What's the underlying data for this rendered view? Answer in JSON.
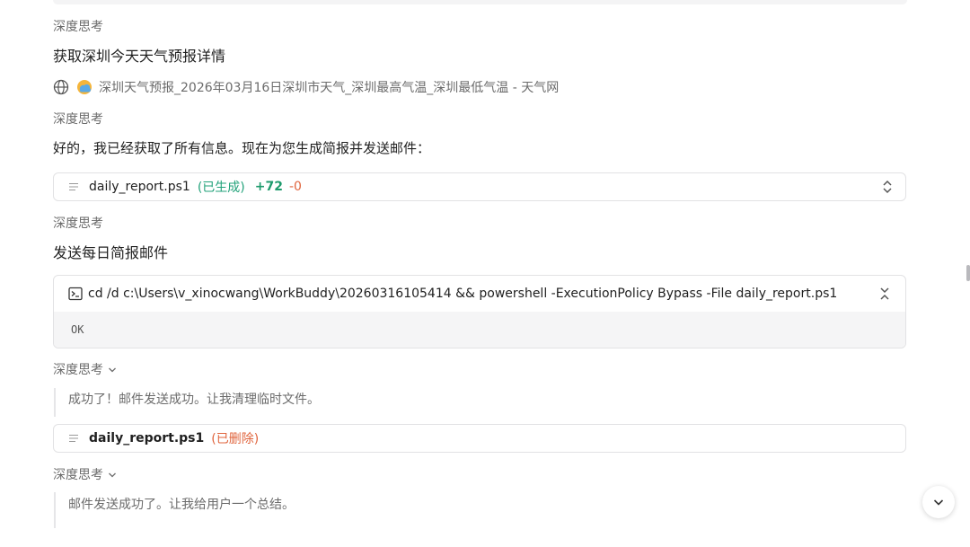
{
  "labels": {
    "deep_think": "深度思考"
  },
  "step1": {
    "heading": "获取深圳今天天气预报详情",
    "source_title": "深圳天气预报_2026年03月16日深圳市天气_深圳最高气温_深圳最低气温 - 天气网"
  },
  "step2": {
    "message": "好的，我已经获取了所有信息。现在为您生成简报并发送邮件：",
    "file": {
      "name": "daily_report.ps1",
      "status": "(已生成)",
      "added": "+72",
      "removed": "-0"
    }
  },
  "step3": {
    "heading": "发送每日简报邮件",
    "command": "cd /d c:\\Users\\v_xinocwang\\WorkBuddy\\20260316105414 && powershell -ExecutionPolicy Bypass -File daily_report.ps1",
    "output": "OK"
  },
  "step4": {
    "thought": "成功了！邮件发送成功。让我清理临时文件。",
    "file": {
      "name": "daily_report.ps1",
      "status": "(已删除)"
    }
  },
  "step5": {
    "thought": "邮件发送成功了。让我给用户一个总结。"
  },
  "colors": {
    "status_generated": "#22a27a",
    "status_deleted": "#e0653e",
    "added": "#1d9a6c",
    "removed": "#e0653e"
  },
  "icons": [
    "globe-icon",
    "weather-icon",
    "file-icon",
    "expand-collapse-icon",
    "terminal-icon",
    "chevron-down-icon"
  ]
}
